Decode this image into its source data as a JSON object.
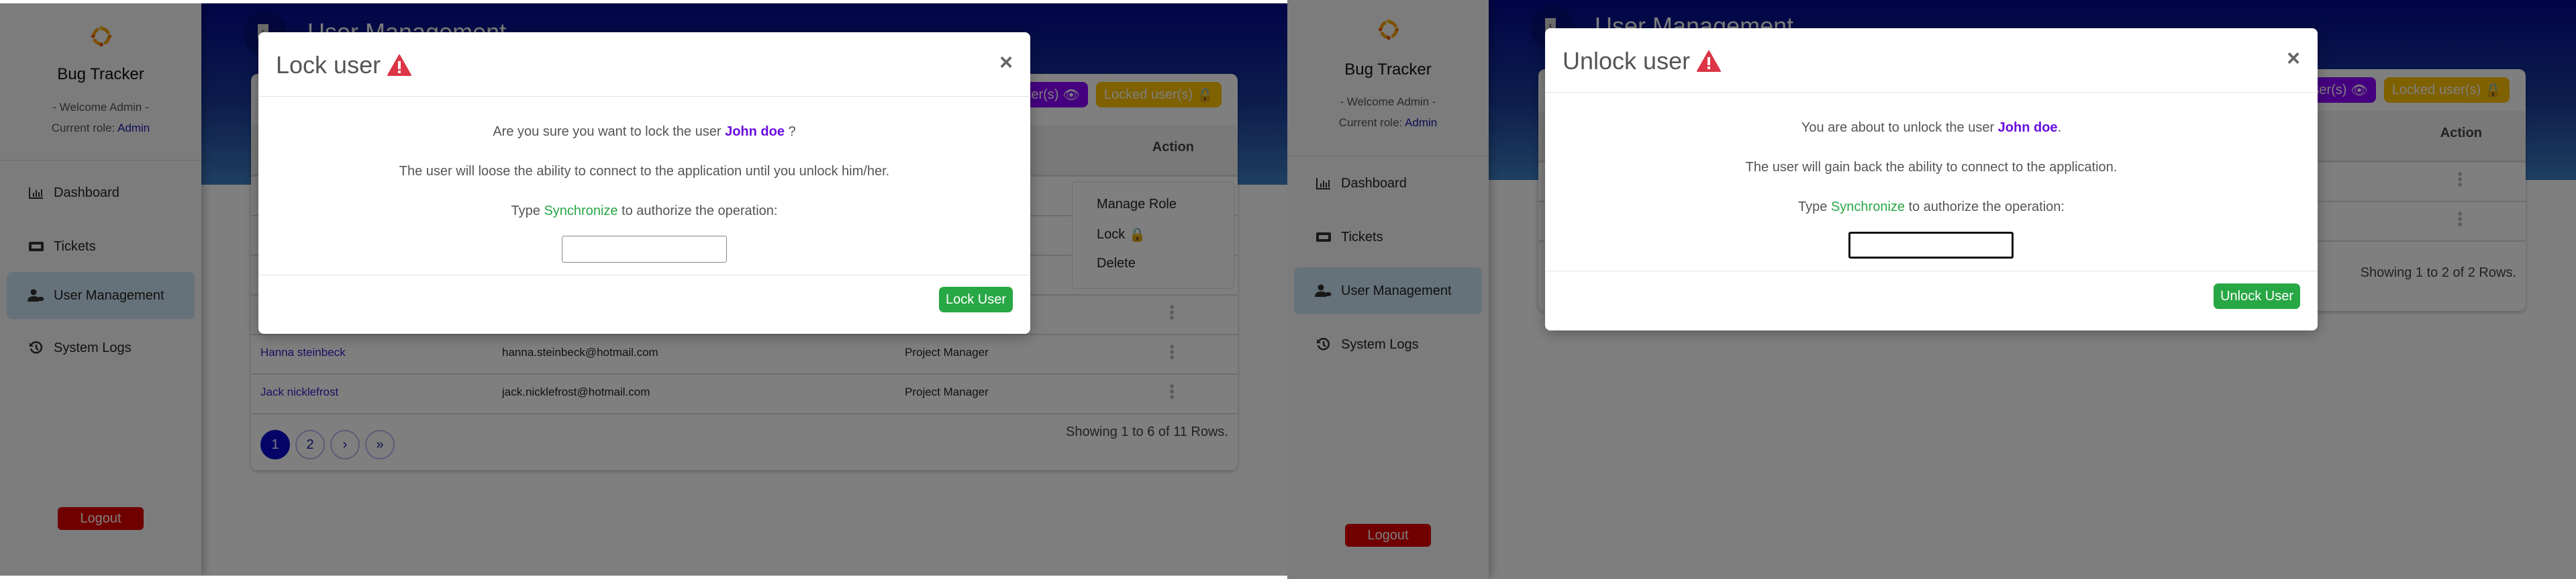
{
  "app": {
    "brand": "Bug Tracker",
    "welcome": "- Welcome Admin -",
    "role_label": "Current role: ",
    "role_value": "Admin",
    "logout_label": "Logout",
    "sidebar": [
      {
        "label": "Dashboard",
        "icon": "chart-bar-icon"
      },
      {
        "label": "Tickets",
        "icon": "ticket-icon"
      },
      {
        "label": "User Management",
        "icon": "user-tag-icon",
        "active": true
      },
      {
        "label": "System Logs",
        "icon": "history-icon"
      }
    ],
    "page_title": "User Management",
    "colors": {
      "accent_blue": "#0a0ad0",
      "success": "#28a745",
      "danger": "#e00000",
      "warning_icon": "#dc3545",
      "user_highlight": "#6a0ddf",
      "badge_purple": "#8a00ff",
      "badge_gold": "#ffc200"
    }
  },
  "left_screen": {
    "badges": {
      "active_users": "g user(s)",
      "locked_users": "Locked user(s)"
    },
    "table": {
      "action_header": "Action",
      "rows": [
        {
          "name": "Hanna steinbeck",
          "email": "hanna.steinbeck@hotmail.com",
          "role": "Project Manager"
        },
        {
          "name": "Jack nicklefrost",
          "email": "jack.nicklefrost@hotmail.com",
          "role": "Project Manager"
        }
      ]
    },
    "dropdown": {
      "items": [
        "Manage Role",
        "Lock",
        "Delete"
      ]
    },
    "pagination": {
      "pages": [
        "1",
        "2"
      ],
      "next": "›",
      "last": "»",
      "current": "1"
    },
    "showing": "Showing 1 to 6 of 11 Rows.",
    "modal": {
      "title": "Lock user",
      "line1_prefix": "Are you sure you want to lock the user ",
      "user": "John doe",
      "line1_suffix": " ?",
      "line2": "The user will loose the ability to connect to the application until you unlock him/her.",
      "line3_prefix": "Type ",
      "keyword": "Synchronize",
      "line3_suffix": " to authorize the operation:",
      "input_value": "",
      "confirm_label": "Lock User",
      "close_label": "×"
    }
  },
  "right_screen": {
    "badges": {
      "active_users": "g user(s)",
      "locked_users": "Locked user(s)"
    },
    "table": {
      "action_header": "Action",
      "row_count": 2
    },
    "showing": "Showing 1 to 2 of 2 Rows.",
    "modal": {
      "title": "Unlock user",
      "line1_prefix": "You are about to unlock the user ",
      "user": "John doe",
      "line1_suffix": ".",
      "line2": "The user will gain back the ability to connect to the application.",
      "line3_prefix": "Type ",
      "keyword": "Synchronize",
      "line3_suffix": " to authorize the operation:",
      "input_value": "",
      "confirm_label": "Unlock User",
      "close_label": "×"
    }
  }
}
